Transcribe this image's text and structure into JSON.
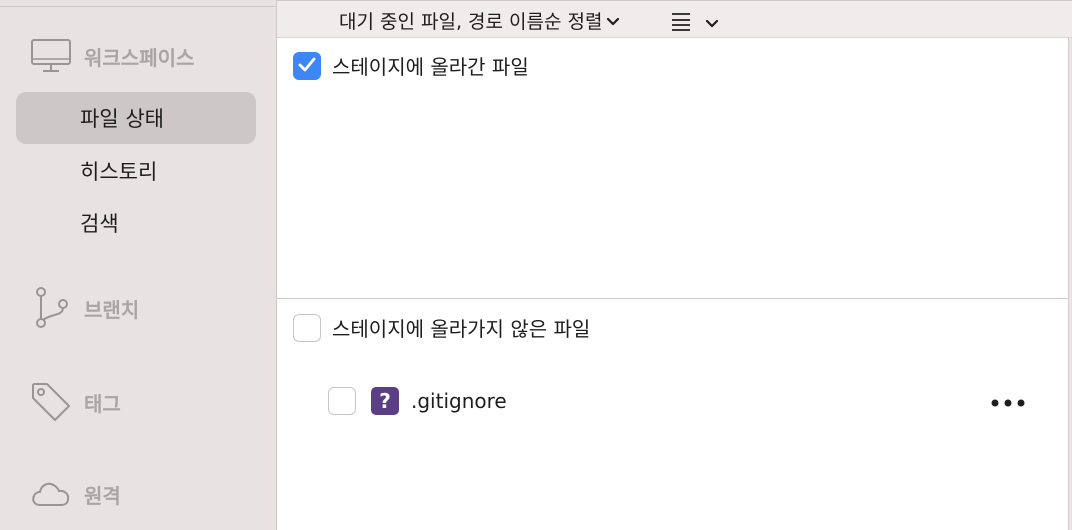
{
  "sidebar": {
    "workspace": {
      "label": "워크스페이스",
      "icon": "monitor-icon"
    },
    "items": [
      {
        "label": "파일 상태",
        "active": true
      },
      {
        "label": "히스토리",
        "active": false
      },
      {
        "label": "검색",
        "active": false
      }
    ],
    "branches": {
      "label": "브랜치",
      "icon": "branch-icon"
    },
    "tags": {
      "label": "태그",
      "icon": "tag-icon"
    },
    "remotes": {
      "label": "원격",
      "icon": "cloud-icon"
    }
  },
  "toolbar": {
    "sort_label": "대기 중인 파일, 경로 이름순 정렬",
    "sort_icon": "chevron-down-icon",
    "view_icon": "list-icon"
  },
  "staged": {
    "header": "스테이지에 올라간 파일",
    "checked": true
  },
  "unstaged": {
    "header": "스테이지에 올라가지 않은 파일",
    "checked": false,
    "files": [
      {
        "name": ".gitignore",
        "status": "?",
        "status_meaning": "untracked",
        "checked": false
      }
    ]
  },
  "colors": {
    "sidebar_bg": "#e8e2e2",
    "selected_item_bg": "#cdc7c7",
    "checkbox_accent": "#3d86f6",
    "untracked_badge": "#5b3f86"
  }
}
